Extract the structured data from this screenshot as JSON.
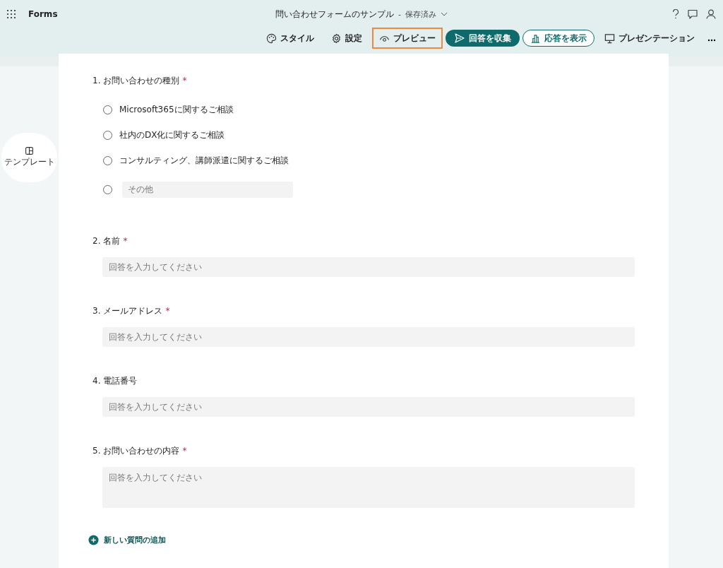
{
  "app": {
    "name": "Forms"
  },
  "document": {
    "title": "問い合わせフォームのサンプル",
    "separator": "-",
    "status": "保存済み"
  },
  "toolbar": [
    {
      "label": "スタイル",
      "kind": "style",
      "highlighted": false
    },
    {
      "label": "設定",
      "kind": "settings",
      "highlighted": false
    },
    {
      "label": "プレビュー",
      "kind": "preview",
      "highlighted": true
    },
    {
      "label": "回答を収集",
      "kind": "collect",
      "highlighted": false
    },
    {
      "label": "応答を表示",
      "kind": "responses",
      "highlighted": false
    },
    {
      "label": "プレゼンテーション",
      "kind": "present",
      "highlighted": false
    }
  ],
  "side_panel": {
    "label": "テンプレート"
  },
  "questions": [
    {
      "number": "1.",
      "title": "お問い合わせの種別",
      "required_mark": "*",
      "kind": "choice",
      "options": [
        {
          "kind": "option",
          "label": "Microsoft365に関するご相談",
          "selected": false
        },
        {
          "kind": "option",
          "label": "社内のDX化に関するご相談",
          "selected": false
        },
        {
          "kind": "option",
          "label": "コンサルティング、講師派遣に関するご相談",
          "selected": false
        },
        {
          "kind": "other",
          "placeholder": "その他",
          "selected": false
        }
      ]
    },
    {
      "number": "2.",
      "title": "名前",
      "required_mark": "*",
      "kind": "text",
      "placeholder": "回答を入力してください"
    },
    {
      "number": "3.",
      "title": "メールアドレス",
      "required_mark": "*",
      "kind": "text",
      "placeholder": "回答を入力してください"
    },
    {
      "number": "4.",
      "title": "電話番号",
      "kind": "text",
      "placeholder": "回答を入力してください"
    },
    {
      "number": "5.",
      "title": "お問い合わせの内容",
      "required_mark": "*",
      "kind": "long",
      "placeholder": "回答を入力してください"
    }
  ],
  "add_question": {
    "label": "新しい質問の追加"
  }
}
